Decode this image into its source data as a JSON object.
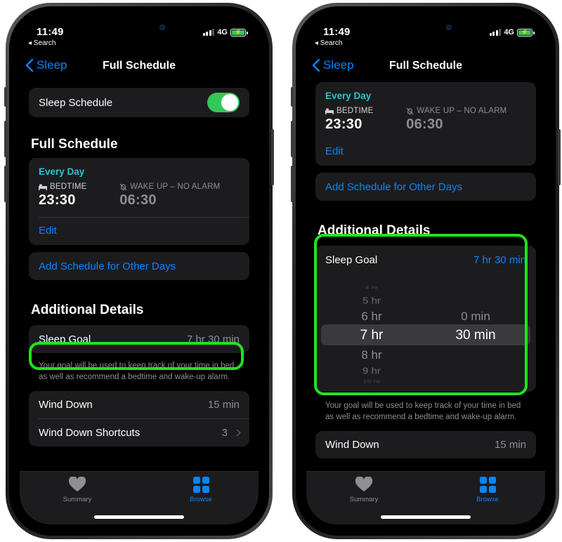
{
  "status": {
    "time": "11:49",
    "back_app": "◂ Search",
    "network": "4G"
  },
  "nav": {
    "back_label": "Sleep",
    "title": "Full Schedule"
  },
  "left": {
    "sleep_schedule_label": "Sleep Schedule",
    "full_schedule_heading": "Full Schedule",
    "schedule": {
      "day": "Every Day",
      "bedtime_label": "BEDTIME",
      "bedtime": "23:30",
      "wakeup_label": "WAKE UP – NO ALARM",
      "wakeup": "06:30",
      "edit": "Edit"
    },
    "add_schedule": "Add Schedule for Other Days",
    "additional_heading": "Additional Details",
    "sleep_goal_label": "Sleep Goal",
    "sleep_goal_value": "7 hr 30 min",
    "goal_note": "Your goal will be used to keep track of your time in bed as well as recommend a bedtime and wake-up alarm.",
    "wind_down_label": "Wind Down",
    "wind_down_value": "15 min",
    "shortcuts_label": "Wind Down Shortcuts",
    "shortcuts_value": "3"
  },
  "right": {
    "schedule": {
      "day": "Every Day",
      "bedtime_label": "BEDTIME",
      "bedtime": "23:30",
      "wakeup_label": "WAKE UP – NO ALARM",
      "wakeup": "06:30",
      "edit": "Edit"
    },
    "add_schedule": "Add Schedule for Other Days",
    "additional_heading": "Additional Details",
    "sleep_goal_label": "Sleep Goal",
    "sleep_goal_value": "7 hr 30 min",
    "picker_hours": [
      "4 hr",
      "5 hr",
      "6 hr",
      "7 hr",
      "8 hr",
      "9 hr",
      "10 hr"
    ],
    "picker_minutes": [
      "0 min",
      "30 min"
    ],
    "goal_note": "Your goal will be used to keep track of your time in bed as well as recommend a bedtime and wake-up alarm.",
    "wind_down_label": "Wind Down",
    "wind_down_value": "15 min"
  },
  "tabs": {
    "summary": "Summary",
    "browse": "Browse"
  },
  "colors": {
    "accent": "#0a84ff",
    "highlight": "#22e21f",
    "toggle_on": "#34c759",
    "day_label": "#2bc3cf"
  }
}
